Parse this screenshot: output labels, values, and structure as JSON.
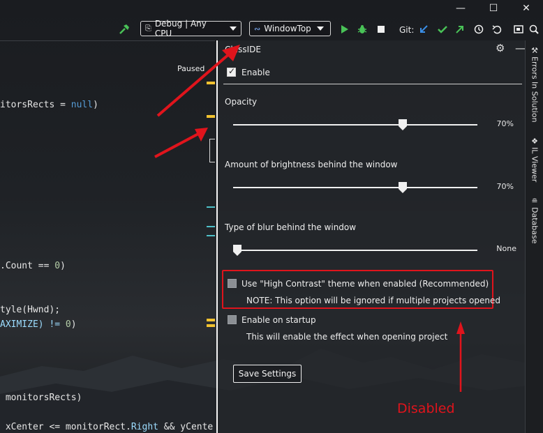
{
  "window": {
    "minimize": "—",
    "maximize": "☐",
    "close": "✕"
  },
  "toolbar": {
    "config_combo": "Debug | Any CPU",
    "project_combo": "WindowTop",
    "git_label": "Git:",
    "icons": [
      "build-hammer-icon",
      "start-icon",
      "debug-bug-icon",
      "stop-icon",
      "git-pull-icon",
      "git-commit-icon",
      "git-push-icon",
      "history-icon",
      "undo-icon",
      "toggle-window-icon",
      "search-icon"
    ]
  },
  "editor": {
    "status": "Paused",
    "lines": [
      {
        "text": "itorsRects = ",
        "keyword": "null",
        "tail": ")"
      },
      {
        "text": ".Count == ",
        "number": "0",
        "tail": ")"
      },
      {
        "text": "tyle(Hwnd);"
      },
      {
        "text": "AXIMIZE) != ",
        "number": "0",
        "tail": ")"
      },
      {
        "text": " monitorsRects)"
      },
      {
        "text": " xCenter <= monitorRect.",
        "prop": "Right",
        "tail": " && yCente"
      }
    ]
  },
  "panel": {
    "title": "ClassIDE",
    "enable_label": "Enable",
    "enable_checked": true,
    "sliders": [
      {
        "label": "Opacity",
        "value_text": "70%",
        "fraction": 0.7
      },
      {
        "label": "Amount of brightness behind the window",
        "value_text": "70%",
        "fraction": 0.7
      },
      {
        "label": "Type of blur behind the window",
        "value_text": "None",
        "fraction": 0.0
      }
    ],
    "high_contrast": {
      "label": "Use \"High Contrast\" theme when enabled (Recommended)",
      "note": "NOTE: This option will be ignored if multiple projects opened",
      "checked": false,
      "disabled": true
    },
    "startup": {
      "label": "Enable on startup",
      "note": "This will enable the effect when opening project",
      "checked": false
    },
    "save_button": "Save Settings",
    "annotation": "Disabled"
  },
  "side_tabs": [
    {
      "label": "Errors In Solution",
      "icon": "wrench-icon"
    },
    {
      "label": "IL Viewer",
      "icon": "diamond-icon"
    },
    {
      "label": "Database",
      "icon": "database-icon"
    }
  ],
  "colors": {
    "accent_red": "#e0141c",
    "keyword_blue": "#569cd6",
    "number_green": "#b5cea8",
    "property_blue": "#9cdcfe",
    "marker_yellow": "#f2c230",
    "marker_cyan": "#4fc1c9",
    "green_icon": "#49c257"
  }
}
